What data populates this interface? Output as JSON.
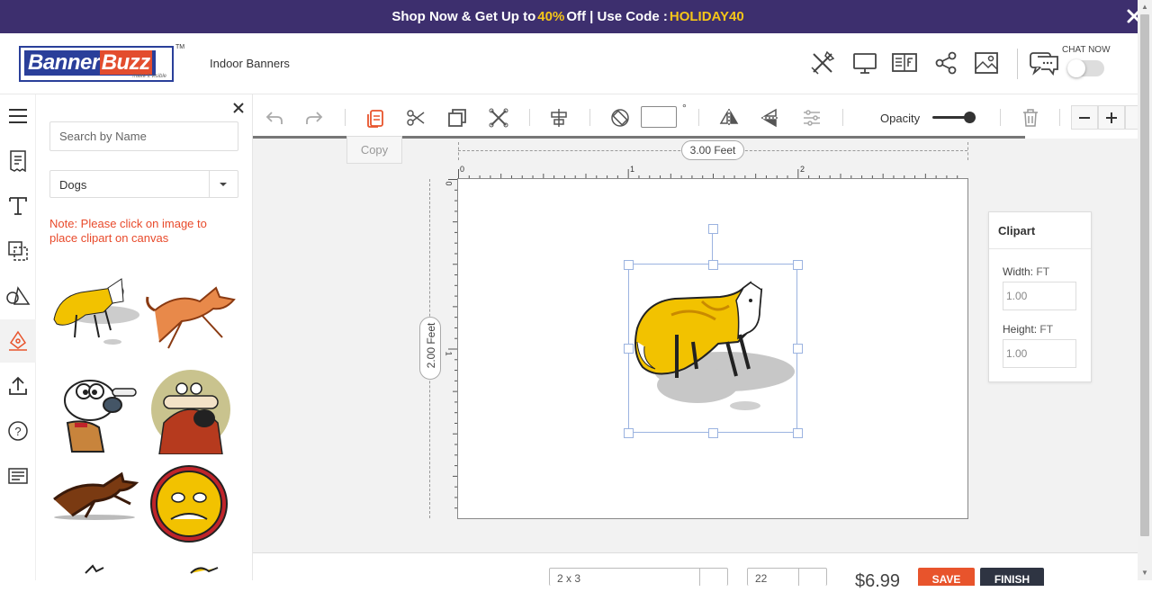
{
  "promo": {
    "text_before": "Shop Now & Get Up to",
    "percent": "40%",
    "text_middle": "Off | Use Code :",
    "code": "HOLIDAY40"
  },
  "header": {
    "logo_text_1": "Banner",
    "logo_text_2": "Buzz",
    "logo_tm": "TM",
    "logo_tagline": "make it visible",
    "product": "Indoor Banners",
    "chat_label": "CHAT NOW",
    "chat_enabled": false
  },
  "panel": {
    "search_placeholder": "Search by Name",
    "category": "Dogs",
    "note": "Note: Please click on image to place clipart on canvas"
  },
  "toolbar": {
    "tooltip": "Copy",
    "rotation_value": "",
    "degree_symbol": "°",
    "opacity_label": "Opacity",
    "opacity_value": 0.85
  },
  "canvas": {
    "width_label": "3.00 Feet",
    "height_label": "2.00 Feet",
    "ruler_h": [
      "0",
      "1",
      "2"
    ],
    "ruler_v": [
      "0",
      "1"
    ]
  },
  "properties": {
    "title": "Clipart",
    "width_label": "Width:",
    "width_unit": "FT",
    "width_value": "1.00",
    "height_label": "Height:",
    "height_unit": "FT",
    "height_value": "1.00"
  },
  "bottom": {
    "select1": "2 x 3",
    "select2": "22",
    "price": "$6.99",
    "save": "SAVE",
    "finish": "FINISH"
  },
  "colors": {
    "promo_bg": "#3d2f6e",
    "promo_highlight": "#f5c518",
    "accent": "#e8542c",
    "note": "#e84a2b",
    "dark_button": "#2e3442",
    "selection": "#9bb3e0"
  }
}
